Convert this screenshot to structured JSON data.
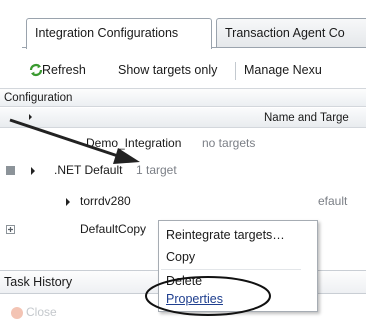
{
  "tabs": [
    {
      "label": "Integration Configurations",
      "active": true
    },
    {
      "label": "Transaction Agent Co",
      "active": false
    }
  ],
  "toolbar": {
    "refresh_label": "Refresh",
    "show_targets_label": "Show targets only",
    "manage_label": "Manage Nexu"
  },
  "grid": {
    "group_header": "Configuration",
    "column_header": "Name and Targe",
    "rows": [
      {
        "name": "Demo_Integration",
        "detail": "no targets"
      },
      {
        "name": ".NET Default",
        "detail": "1 target"
      },
      {
        "name": "torrdv280",
        "detail": "efault"
      },
      {
        "name": "DefaultCopy",
        "detail": ""
      }
    ]
  },
  "context_menu": {
    "items": [
      "Reintegrate targets…",
      "Copy",
      "Delete",
      "Properties"
    ]
  },
  "task_history": {
    "title": "Task History",
    "close_label": "Close"
  },
  "colors": {
    "menu_link": "#1f3f8f",
    "arrow": "#222222",
    "refresh_icon": "#3a9a2f"
  }
}
